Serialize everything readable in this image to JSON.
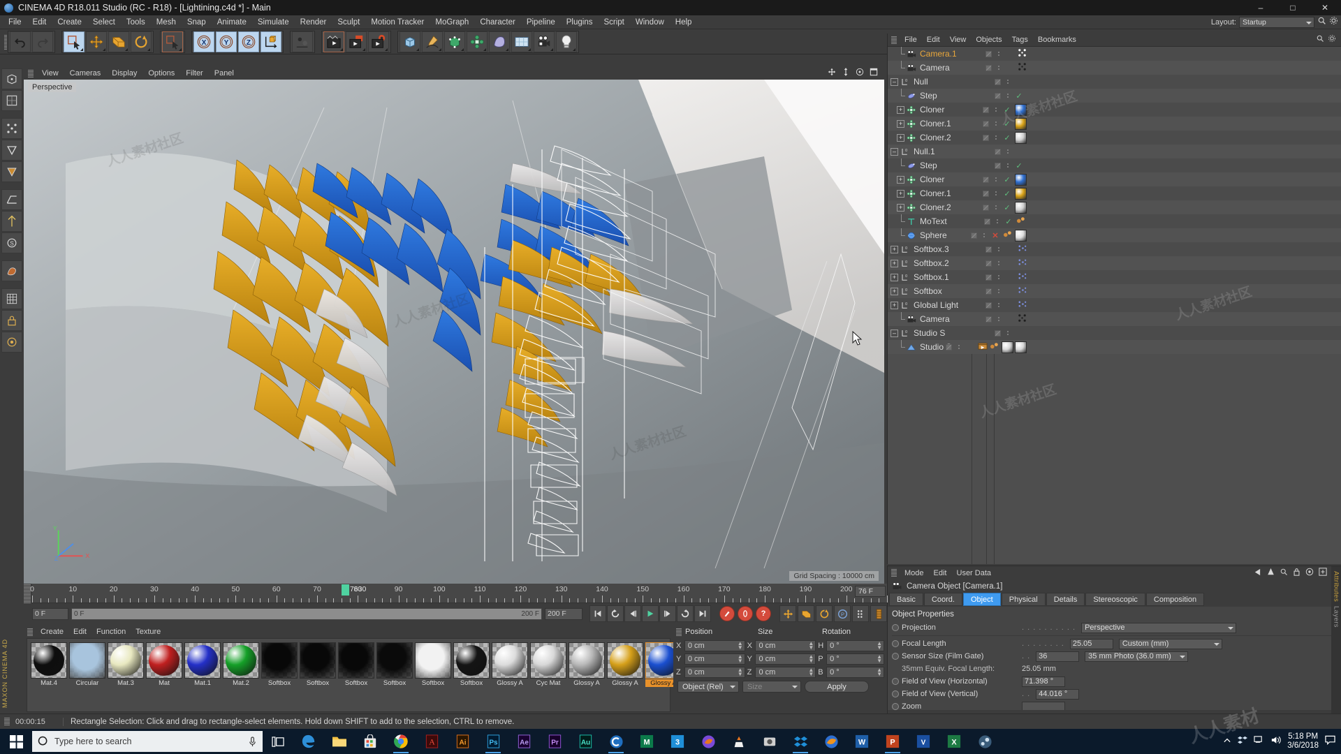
{
  "window": {
    "title": "CINEMA 4D R18.011 Studio (RC - R18) - [Lightining.c4d *] - Main",
    "minimize": "–",
    "maximize": "□",
    "close": "✕"
  },
  "menubar": {
    "items": [
      "File",
      "Edit",
      "Create",
      "Select",
      "Tools",
      "Mesh",
      "Snap",
      "Animate",
      "Simulate",
      "Render",
      "Sculpt",
      "Motion Tracker",
      "MoGraph",
      "Character",
      "Pipeline",
      "Plugins",
      "Script",
      "Window",
      "Help"
    ],
    "layout_label": "Layout:",
    "layout_value": "Startup"
  },
  "toolbar": {
    "icons": [
      "undo-icon",
      "redo-icon",
      "live-selection-icon",
      "move-icon",
      "scale-icon",
      "rotate-icon",
      "selection-arrow-icon",
      "axis-x-icon",
      "axis-y-icon",
      "axis-z-icon",
      "world-object-axis-icon",
      "coordinate-system-icon",
      "render-view-icon",
      "render-region-icon",
      "render-settings-icon",
      "cube-primitive-icon",
      "spline-pen-icon",
      "nurbs-icon",
      "mograph-array-icon",
      "deformer-icon",
      "environment-icon",
      "camera-icon",
      "light-icon"
    ]
  },
  "left_tools": {
    "icons": [
      "model-mode-icon",
      "texture-mode-icon",
      "points-mode-icon",
      "edges-mode-icon",
      "polygons-mode-icon",
      "workplane-icon",
      "enable-axis-icon",
      "enable-snap-icon",
      "viewport-solo-icon",
      "deformer-on-icon",
      "texture-axis-icon",
      "lock-axis-icon",
      "clamp-icon"
    ],
    "brand": "MAXON CINEMA 4D"
  },
  "viewport": {
    "menu": [
      "View",
      "Cameras",
      "Display",
      "Options",
      "Filter",
      "Panel"
    ],
    "label": "Perspective",
    "grid_spacing": "Grid Spacing : 10000 cm",
    "nav_icons": [
      "pan-icon",
      "dolly-icon",
      "orbit-icon",
      "maximize-viewport-icon"
    ]
  },
  "object_manager": {
    "menu": [
      "File",
      "Edit",
      "View",
      "Objects",
      "Tags",
      "Bookmarks"
    ],
    "icons": [
      "search-icon",
      "settings-icon"
    ],
    "objects": [
      {
        "name": "Camera.1",
        "icon": "camera-icon",
        "depth": 1,
        "expander": "none",
        "selected": true,
        "vis": true,
        "tag": "none",
        "check": "none",
        "swatch": null,
        "extra": "transform-tag"
      },
      {
        "name": "Camera",
        "icon": "camera-icon",
        "depth": 1,
        "expander": "none",
        "selected": false,
        "vis": true,
        "tag": "none",
        "check": "none",
        "swatch": null,
        "extra": "transform-tag"
      },
      {
        "name": "Null",
        "icon": "null-icon",
        "depth": 0,
        "expander": "minus",
        "selected": false,
        "vis": true,
        "tag": "none",
        "check": "none",
        "swatch": null,
        "extra": ""
      },
      {
        "name": "Step",
        "icon": "effector-icon",
        "depth": 1,
        "expander": "none",
        "selected": false,
        "vis": true,
        "tag": "none",
        "check": "green",
        "swatch": null,
        "extra": ""
      },
      {
        "name": "Cloner",
        "icon": "cloner-icon",
        "depth": 1,
        "expander": "plus",
        "selected": false,
        "vis": true,
        "tag": "none",
        "check": "green",
        "swatch": "#2f6fd0",
        "extra": ""
      },
      {
        "name": "Cloner.1",
        "icon": "cloner-icon",
        "depth": 1,
        "expander": "plus",
        "selected": false,
        "vis": true,
        "tag": "none",
        "check": "green",
        "swatch": "#d9a318",
        "extra": ""
      },
      {
        "name": "Cloner.2",
        "icon": "cloner-icon",
        "depth": 1,
        "expander": "plus",
        "selected": false,
        "vis": true,
        "tag": "none",
        "check": "green",
        "swatch": "#cfcfcf",
        "extra": ""
      },
      {
        "name": "Null.1",
        "icon": "null-icon",
        "depth": 0,
        "expander": "minus",
        "selected": false,
        "vis": true,
        "tag": "none",
        "check": "none",
        "swatch": null,
        "extra": ""
      },
      {
        "name": "Step",
        "icon": "effector-icon",
        "depth": 1,
        "expander": "none",
        "selected": false,
        "vis": true,
        "tag": "none",
        "check": "green",
        "swatch": null,
        "extra": ""
      },
      {
        "name": "Cloner",
        "icon": "cloner-icon",
        "depth": 1,
        "expander": "plus",
        "selected": false,
        "vis": true,
        "tag": "none",
        "check": "green",
        "swatch": "#2f6fd0",
        "extra": ""
      },
      {
        "name": "Cloner.1",
        "icon": "cloner-icon",
        "depth": 1,
        "expander": "plus",
        "selected": false,
        "vis": true,
        "tag": "none",
        "check": "green",
        "swatch": "#d9a318",
        "extra": ""
      },
      {
        "name": "Cloner.2",
        "icon": "cloner-icon",
        "depth": 1,
        "expander": "plus",
        "selected": false,
        "vis": true,
        "tag": "none",
        "check": "green",
        "swatch": "#cfcfcf",
        "extra": ""
      },
      {
        "name": "MoText",
        "icon": "motext-icon",
        "depth": 1,
        "expander": "none",
        "selected": false,
        "vis": true,
        "tag": "none",
        "check": "green",
        "swatch": null,
        "extra": "mo-tag"
      },
      {
        "name": "Sphere",
        "icon": "sphere-icon",
        "depth": 1,
        "expander": "none",
        "selected": false,
        "vis": true,
        "tag": "none",
        "check": "red",
        "swatch": "#dedede",
        "extra": "mo-tag"
      },
      {
        "name": "Softbox.3",
        "icon": "null-icon",
        "depth": 0,
        "expander": "plus",
        "selected": false,
        "vis": true,
        "tag": "none",
        "check": "none",
        "swatch": null,
        "extra": "blue-tag"
      },
      {
        "name": "Softbox.2",
        "icon": "null-icon",
        "depth": 0,
        "expander": "plus",
        "selected": false,
        "vis": true,
        "tag": "none",
        "check": "none",
        "swatch": null,
        "extra": "blue-tag"
      },
      {
        "name": "Softbox.1",
        "icon": "null-icon",
        "depth": 0,
        "expander": "plus",
        "selected": false,
        "vis": true,
        "tag": "none",
        "check": "none",
        "swatch": null,
        "extra": "blue-tag"
      },
      {
        "name": "Softbox",
        "icon": "null-icon",
        "depth": 0,
        "expander": "plus",
        "selected": false,
        "vis": true,
        "tag": "none",
        "check": "none",
        "swatch": null,
        "extra": "blue-tag"
      },
      {
        "name": "Global Light",
        "icon": "null-icon",
        "depth": 0,
        "expander": "plus",
        "selected": false,
        "vis": true,
        "tag": "none",
        "check": "none",
        "swatch": null,
        "extra": "blue-tag"
      },
      {
        "name": "Camera",
        "icon": "camera-icon",
        "depth": 1,
        "expander": "none",
        "selected": false,
        "vis": true,
        "tag": "none",
        "check": "none",
        "swatch": null,
        "extra": "transform-tag"
      },
      {
        "name": "Studio S",
        "icon": "null-icon",
        "depth": 0,
        "expander": "minus",
        "selected": false,
        "vis": true,
        "tag": "none",
        "check": "none",
        "swatch": null,
        "extra": ""
      },
      {
        "name": "Studio S",
        "icon": "floor-icon",
        "depth": 1,
        "expander": "none",
        "selected": false,
        "vis": true,
        "tag": "none",
        "check": "none",
        "swatch": "#d6d6d6",
        "extra": "studio-tags"
      }
    ]
  },
  "attributes": {
    "menu": [
      "Mode",
      "Edit",
      "User Data"
    ],
    "header": "Camera Object [Camera.1]",
    "nav_icons": [
      "back-arrow-icon",
      "up-arrow-icon",
      "search-icon",
      "lock-icon",
      "target-icon",
      "add-icon"
    ],
    "tabs": [
      "Basic",
      "Coord.",
      "Object",
      "Physical",
      "Details",
      "Stereoscopic",
      "Composition"
    ],
    "active_tab": "Object",
    "group_title": "Object Properties",
    "rows": [
      {
        "label": "Projection",
        "type": "dropdown",
        "value": "Perspective",
        "unit": ""
      },
      {
        "label": "Focal Length",
        "type": "field+dropdown",
        "value": "25.05",
        "unit": "Custom (mm)"
      },
      {
        "label": "Sensor Size (Film Gate)",
        "type": "field+dropdown",
        "value": "36",
        "unit": "35 mm Photo (36.0 mm)"
      },
      {
        "label": "35mm Equiv. Focal Length:",
        "type": "readonly",
        "value": "25.05 mm",
        "unit": ""
      },
      {
        "label": "Field of View (Horizontal)",
        "type": "field",
        "value": "71.398 °",
        "unit": ""
      },
      {
        "label": "Field of View (Vertical)",
        "type": "field",
        "value": "44.016 °",
        "unit": ""
      },
      {
        "label": "Zoom",
        "type": "field",
        "value": "",
        "unit": ""
      }
    ],
    "side_tabs": [
      "Attributes",
      "Layers"
    ]
  },
  "timeline": {
    "ticks": [
      "0",
      "10",
      "20",
      "30",
      "40",
      "50",
      "60",
      "70",
      "80",
      "90",
      "100",
      "110",
      "120",
      "130",
      "140",
      "150",
      "160",
      "170",
      "180",
      "190",
      "200"
    ],
    "playhead_label": "7630",
    "frame_right": "76 F",
    "current_frame": "0 F",
    "range_start": "0 F",
    "range_end": "200 F",
    "range_total": "200 F",
    "transport": [
      "go-to-start-icon",
      "play-reverse-loop-icon",
      "step-back-icon",
      "play-icon",
      "step-forward-icon",
      "loop-icon",
      "go-to-end-icon"
    ],
    "record_buttons": [
      "record-keyframe-icon",
      "autokey-icon",
      "keyframe-selection-icon"
    ],
    "key_toggles": [
      "position-key-icon",
      "scale-key-icon",
      "rotation-key-icon",
      "param-key-icon",
      "pla-key-icon",
      "timeline-icon"
    ]
  },
  "materials": {
    "menu": [
      "Create",
      "Edit",
      "Function",
      "Texture"
    ],
    "items": [
      {
        "name": "Mat.4",
        "kind": "sphere",
        "color": "#0e0e0e",
        "selected": false
      },
      {
        "name": "Circular",
        "kind": "square",
        "color": "#a8c4dd",
        "selected": false
      },
      {
        "name": "Mat.3",
        "kind": "sphere",
        "color": "#e8e8c0",
        "selected": false
      },
      {
        "name": "Mat",
        "kind": "sphere",
        "color": "#c02020",
        "selected": false
      },
      {
        "name": "Mat.1",
        "kind": "sphere",
        "color": "#2430c8",
        "selected": false
      },
      {
        "name": "Mat.2",
        "kind": "sphere",
        "color": "#15a028",
        "selected": false
      },
      {
        "name": "Softbox",
        "kind": "square",
        "color": "#080808",
        "selected": false
      },
      {
        "name": "Softbox",
        "kind": "square",
        "color": "#080808",
        "selected": false
      },
      {
        "name": "Softbox",
        "kind": "square",
        "color": "#080808",
        "selected": false
      },
      {
        "name": "Softbox",
        "kind": "square",
        "color": "#0a0a0a",
        "selected": false
      },
      {
        "name": "Softbox",
        "kind": "square",
        "color": "#f2f2f2",
        "selected": false
      },
      {
        "name": "Softbox",
        "kind": "sphere",
        "color": "#151515",
        "selected": false
      },
      {
        "name": "Glossy A",
        "kind": "sphere",
        "color": "#dcdcdc",
        "selected": false
      },
      {
        "name": "Cyc Mat",
        "kind": "sphere",
        "color": "#d8d8d8",
        "selected": false
      },
      {
        "name": "Glossy A",
        "kind": "sphere",
        "color": "#b8b8b8",
        "selected": false
      },
      {
        "name": "Glossy A",
        "kind": "sphere",
        "color": "#d6a01a",
        "selected": false
      },
      {
        "name": "Glossy A",
        "kind": "sphere",
        "color": "#1a4fd0",
        "selected": true
      }
    ]
  },
  "coordinates": {
    "headers": [
      "Position",
      "Size",
      "Rotation"
    ],
    "rows": [
      {
        "ax1": "X",
        "v1": "0 cm",
        "ax2": "X",
        "v2": "0 cm",
        "ax3": "H",
        "v3": "0 °"
      },
      {
        "ax1": "Y",
        "v1": "0 cm",
        "ax2": "Y",
        "v2": "0 cm",
        "ax3": "P",
        "v3": "0 °"
      },
      {
        "ax1": "Z",
        "v1": "0 cm",
        "ax2": "Z",
        "v2": "0 cm",
        "ax3": "B",
        "v3": "0 °"
      }
    ],
    "mode": "Object (Rel)",
    "size_mode": "Size",
    "apply": "Apply"
  },
  "status": {
    "time": "00:00:15",
    "message": "Rectangle Selection: Click and drag to rectangle-select elements. Hold down SHIFT to add to the selection, CTRL to remove."
  },
  "taskbar": {
    "search_placeholder": "Type here to search",
    "icons": [
      "start-icon",
      "search-icon",
      "microphone-icon",
      "task-view-icon",
      "edge-icon",
      "file-explorer-icon",
      "store-icon",
      "chrome-icon",
      "acrobat-icon",
      "illustrator-icon",
      "photoshop-icon",
      "after-effects-icon",
      "premiere-icon",
      "audition-icon",
      "cinema4d-icon",
      "maya-icon",
      "3dsmax-icon",
      "firefox-icon",
      "vlc-icon",
      "capture-icon",
      "dropbox-icon",
      "firefox2-icon",
      "word-icon",
      "powerpoint-icon",
      "vegas-icon",
      "excel-icon",
      "steam-icon"
    ],
    "tray": [
      "chevron-up-icon",
      "dropbox-tray-icon",
      "network-icon",
      "volume-icon"
    ],
    "time": "5:18 PM",
    "date": "3/6/2018",
    "action_center": "notifications-icon"
  },
  "colors": {
    "accent_blue": "#3f9bf0",
    "selected_orange": "#e9a73c",
    "material_selected": "#e8912a",
    "playhead_green": "#4fd2a0",
    "panel_bg": "#3c3c3c",
    "list_bg": "#4e4e4e"
  }
}
